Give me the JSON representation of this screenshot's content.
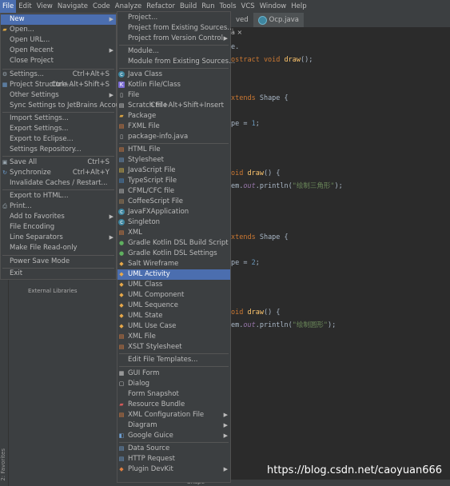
{
  "menubar": [
    "File",
    "Edit",
    "View",
    "Navigate",
    "Code",
    "Analyze",
    "Refactor",
    "Build",
    "Run",
    "Tools",
    "VCS",
    "Window",
    "Help"
  ],
  "tabs": [
    "ved",
    "Ocp.java"
  ],
  "breadcrumb": "a ×",
  "code": {
    "l1": "e.",
    "l2_kw": "ostract void ",
    "l2_fn": "draw",
    "l2_end": "();",
    "l3_kw": "xtends ",
    "l3_type": "Shape {",
    "l4_a": "pe = ",
    "l4_n": "1",
    "l4_end": ";",
    "l5_kw": "oid ",
    "l5_fn": "draw",
    "l5_end": "() {",
    "l6_a": "em.",
    "l6_f": "out",
    "l6_b": ".println(",
    "l6_s": "\"绘制三角形\"",
    "l6_end": ");",
    "l7_kw": "xtends ",
    "l7_type": "Shape {",
    "l8_a": "pe = ",
    "l8_n": "2",
    "l8_end": ";",
    "l9_kw": "oid ",
    "l9_fn": "draw",
    "l9_end": "() {",
    "l10_a": "em.",
    "l10_f": "out",
    "l10_b": ".println(",
    "l10_s": "\"绘制圆形\"",
    "l10_end": ");"
  },
  "project_panel": {
    "external_libraries": "External Libraries"
  },
  "left_strip": {
    "favorites": "2: Favorites"
  },
  "status": {
    "shape_label": "Shape"
  },
  "watermark": "https://blog.csdn.net/caoyuan666",
  "file_menu": {
    "new": "New",
    "open": "Open...",
    "open_url": "Open URL...",
    "open_recent": "Open Recent",
    "close_project": "Close Project",
    "settings": "Settings...",
    "settings_sc": "Ctrl+Alt+S",
    "project_structure": "Project Structure...",
    "project_structure_sc": "Ctrl+Alt+Shift+S",
    "other_settings": "Other Settings",
    "sync_settings": "Sync Settings to JetBrains Account...",
    "import_settings": "Import Settings...",
    "export_settings": "Export Settings...",
    "export_eclipse": "Export to Eclipse...",
    "settings_repo": "Settings Repository...",
    "save_all": "Save All",
    "save_all_sc": "Ctrl+S",
    "synchronize": "Synchronize",
    "synchronize_sc": "Ctrl+Alt+Y",
    "invalidate": "Invalidate Caches / Restart...",
    "export_html": "Export to HTML...",
    "print": "Print...",
    "add_favorites": "Add to Favorites",
    "file_encoding": "File Encoding",
    "line_separators": "Line Separators",
    "make_readonly": "Make File Read-only",
    "power_save": "Power Save Mode",
    "exit": "Exit"
  },
  "new_menu": {
    "project": "Project...",
    "project_existing": "Project from Existing Sources...",
    "project_vcs": "Project from Version Control",
    "module": "Module...",
    "module_existing": "Module from Existing Sources...",
    "java_class": "Java Class",
    "kotlin_file": "Kotlin File/Class",
    "file": "File",
    "scratch_file": "Scratch File",
    "scratch_file_sc": "Ctrl+Alt+Shift+Insert",
    "package": "Package",
    "fxml_file": "FXML File",
    "package_info": "package-info.java",
    "html_file": "HTML File",
    "stylesheet": "Stylesheet",
    "js_file": "JavaScript File",
    "ts_file": "TypeScript File",
    "cfml_file": "CFML/CFC file",
    "coffee_file": "CoffeeScript File",
    "javafx_app": "JavaFXApplication",
    "singleton": "Singleton",
    "xml": "XML",
    "gradle_build": "Gradle Kotlin DSL Build Script",
    "gradle_settings": "Gradle Kotlin DSL Settings",
    "salt_wireframe": "Salt Wireframe",
    "uml_activity": "UML Activity",
    "uml_class": "UML Class",
    "uml_component": "UML Component",
    "uml_sequence": "UML Sequence",
    "uml_state": "UML State",
    "uml_usecase": "UML Use Case",
    "xml_file": "XML File",
    "xslt_stylesheet": "XSLT Stylesheet",
    "edit_templates": "Edit File Templates...",
    "gui_form": "GUI Form",
    "dialog": "Dialog",
    "form_snapshot": "Form Snapshot",
    "resource_bundle": "Resource Bundle",
    "xml_config": "XML Configuration File",
    "diagram": "Diagram",
    "google_guice": "Google Guice",
    "data_source": "Data Source",
    "http_request": "HTTP Request",
    "plugin_devkit": "Plugin DevKit"
  },
  "colors": {
    "menu_bg": "#3c3f41",
    "highlight": "#4b6eaf",
    "editor_bg": "#2b2b2b"
  }
}
